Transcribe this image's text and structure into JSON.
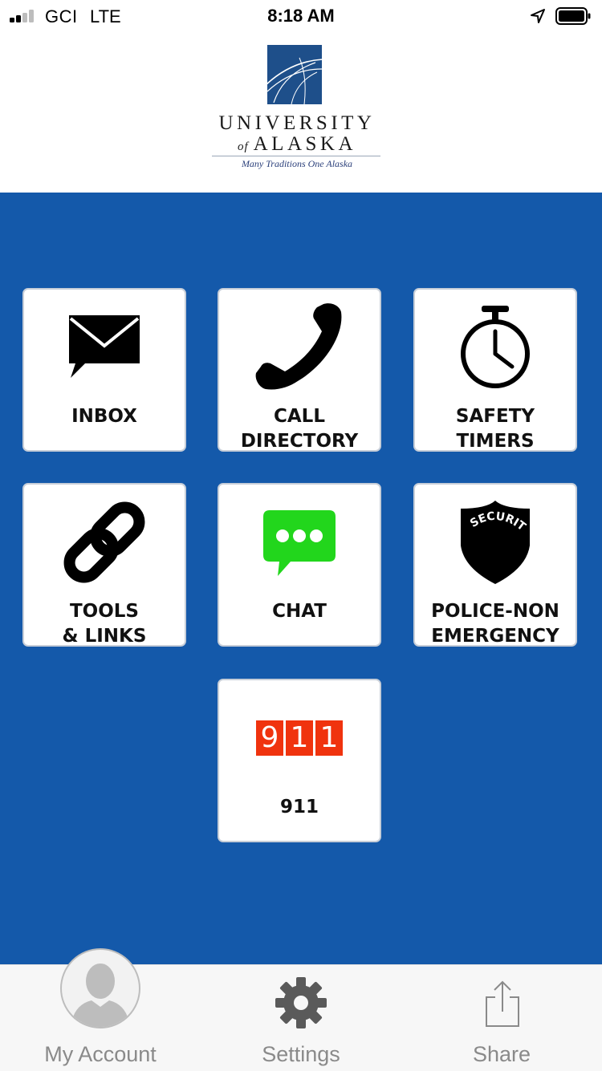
{
  "status_bar": {
    "carrier": "GCI",
    "network": "LTE",
    "time": "8:18 AM",
    "icons": [
      "signal-icon",
      "location-arrow-icon",
      "battery-icon"
    ]
  },
  "header": {
    "logo_name": "UNIVERSITY",
    "logo_of": "of",
    "logo_state": "ALASKA",
    "logo_tagline": "Many Traditions One Alaska"
  },
  "colors": {
    "main_background": "#1459aa",
    "tile_background": "#ffffff",
    "chat_green": "#22d61c",
    "alert_red": "#f0330e"
  },
  "tiles": [
    {
      "label": "INBOX",
      "icon": "envelope-icon"
    },
    {
      "label": "CALL\nDIRECTORY",
      "icon": "phone-icon"
    },
    {
      "label": "SAFETY\nTIMERS",
      "icon": "stopwatch-icon"
    },
    {
      "label": "TOOLS\n& LINKS",
      "icon": "link-icon"
    },
    {
      "label": "CHAT",
      "icon": "chat-bubble-icon"
    },
    {
      "label": "POLICE-NON\nEMERGENCY",
      "icon": "security-shield-icon",
      "badge_text": "SECURITY"
    },
    {
      "label": "911",
      "icon": "911-icon",
      "digits": [
        "9",
        "1",
        "1"
      ]
    }
  ],
  "tab_bar": [
    {
      "label": "My Account",
      "icon": "avatar-icon"
    },
    {
      "label": "Settings",
      "icon": "gear-icon"
    },
    {
      "label": "Share",
      "icon": "share-icon"
    }
  ]
}
